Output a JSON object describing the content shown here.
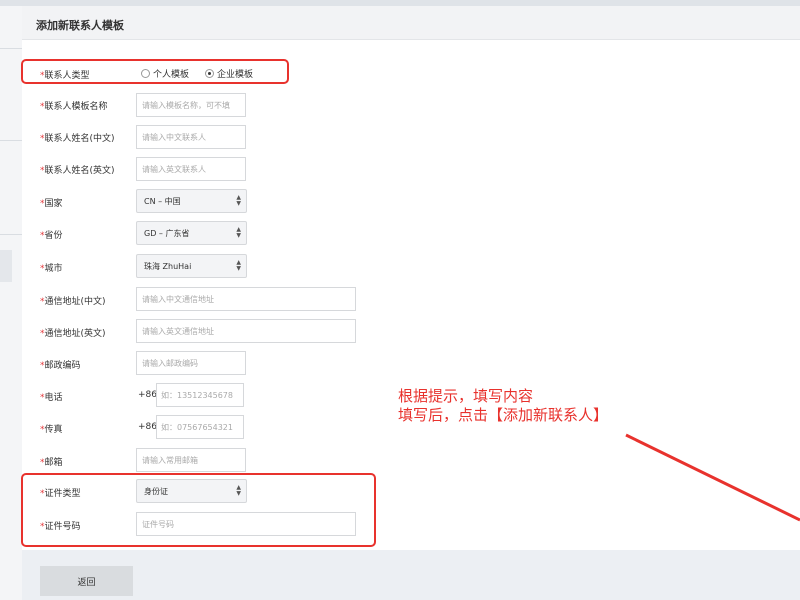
{
  "header": {
    "title": "添加新联系人模板"
  },
  "form": {
    "contact_type": {
      "label": "联系人类型",
      "options": [
        {
          "label": "个人模板",
          "checked": false
        },
        {
          "label": "企业模板",
          "checked": true
        }
      ]
    },
    "template_name": {
      "label": "联系人模板名称",
      "placeholder": "请输入模板名称，可不填"
    },
    "name_cn": {
      "label": "联系人姓名(中文)",
      "placeholder": "请输入中文联系人"
    },
    "name_en": {
      "label": "联系人姓名(英文)",
      "placeholder": "请输入英文联系人"
    },
    "country": {
      "label": "国家",
      "value": "CN – 中国"
    },
    "province": {
      "label": "省份",
      "value": "GD – 广东省"
    },
    "city": {
      "label": "城市",
      "value": "珠海 ZhuHai"
    },
    "address_cn": {
      "label": "通信地址(中文)",
      "placeholder": "请输入中文通信地址"
    },
    "address_en": {
      "label": "通信地址(英文)",
      "placeholder": "请输入英文通信地址"
    },
    "postcode": {
      "label": "邮政编码",
      "placeholder": "请输入邮政编码"
    },
    "phone": {
      "label": "电话",
      "prefix": "+86",
      "placeholder": "如：13512345678"
    },
    "fax": {
      "label": "传真",
      "prefix": "+86",
      "placeholder": "如：07567654321"
    },
    "email": {
      "label": "邮箱",
      "placeholder": "请输入常用邮箱"
    },
    "id_type": {
      "label": "证件类型",
      "value": "身份证"
    },
    "id_number": {
      "label": "证件号码",
      "placeholder": "证件号码"
    }
  },
  "annotation": {
    "line1": "根据提示，填写内容",
    "line2": "填写后，点击【添加新联系人】"
  },
  "footer": {
    "back_label": "返回"
  },
  "colors": {
    "required_star": "#e4393c",
    "annotation_red": "#e8322d"
  }
}
